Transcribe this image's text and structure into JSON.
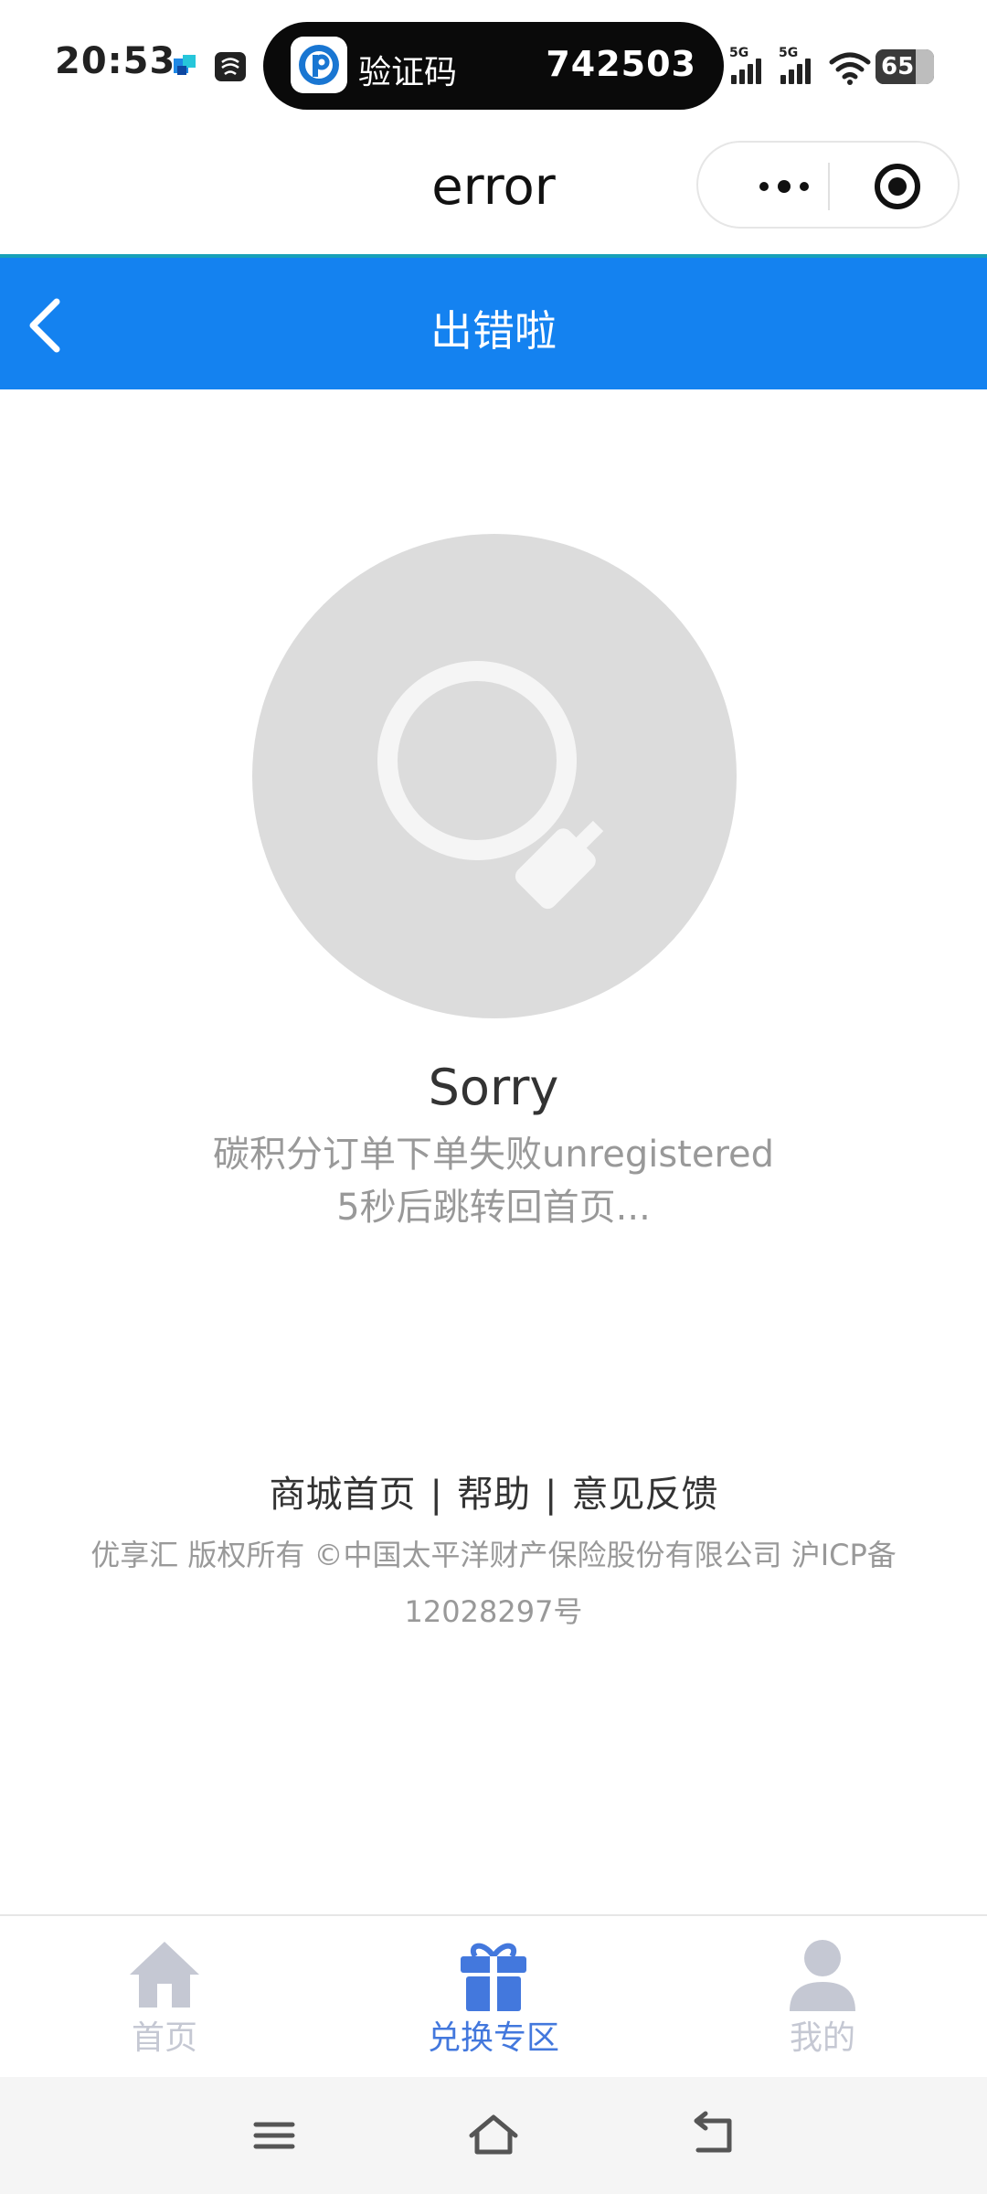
{
  "status_bar": {
    "time": "20:53",
    "sms_notification": {
      "label": "验证码",
      "code": "742503"
    },
    "signal_1_label": "5G",
    "signal_2_label": "5G",
    "battery_level": "65",
    "icons": [
      "app-notification-icon",
      "app-notification-icon-2",
      "signal-icon",
      "signal-icon",
      "wifi-icon",
      "battery-icon"
    ]
  },
  "mini_program": {
    "title": "error",
    "capsule": {
      "more_icon": "more-dots-icon",
      "close_icon": "target-circle-icon"
    }
  },
  "header": {
    "title": "出错啦",
    "back_icon": "chevron-left-icon",
    "color": "#1482f0"
  },
  "error": {
    "icon": "search-magnifier-icon",
    "title": "Sorry",
    "message": "碳积分订单下单失败unregistered",
    "redirect": "5秒后跳转回首页..."
  },
  "footer": {
    "links": [
      "商城首页",
      "帮助",
      "意见反馈"
    ],
    "separator": "|",
    "copyright_line1": "优享汇 版权所有 ©中国太平洋财产保险股份有限公司 沪ICP备",
    "copyright_line2": "12028297号"
  },
  "tab_bar": {
    "items": [
      {
        "label": "首页",
        "icon": "home-icon",
        "active": false
      },
      {
        "label": "兑换专区",
        "icon": "gift-icon",
        "active": true
      },
      {
        "label": "我的",
        "icon": "user-icon",
        "active": false
      }
    ],
    "active_color": "#4378dd",
    "inactive_color": "#c5c8d3"
  },
  "system_nav": {
    "icons": [
      "menu-icon",
      "home-outline-icon",
      "back-icon"
    ]
  }
}
